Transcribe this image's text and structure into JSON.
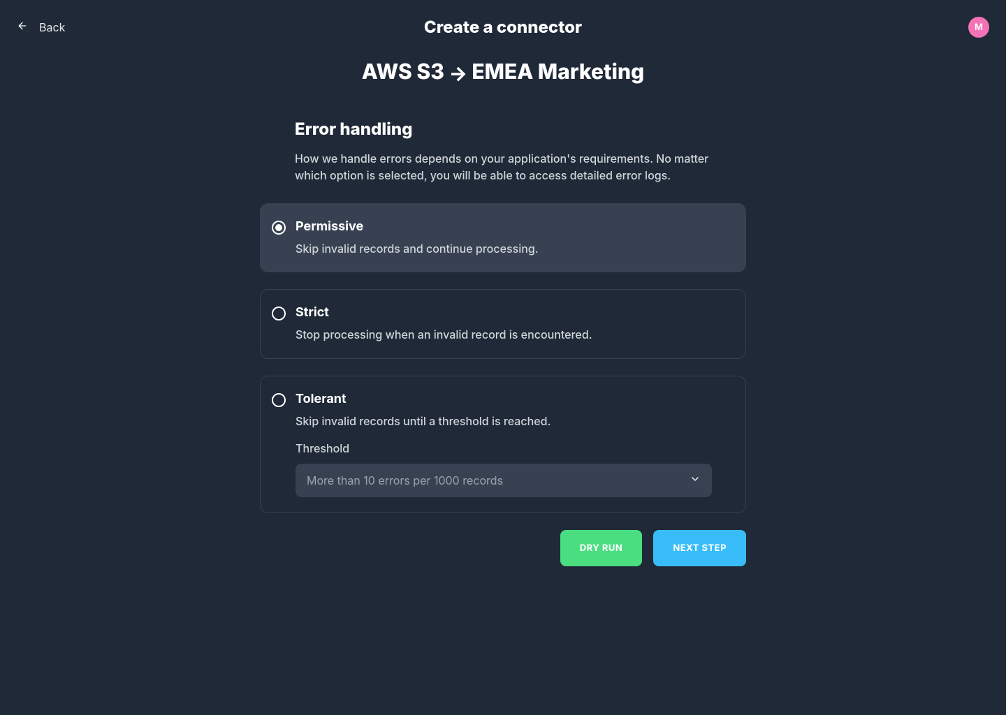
{
  "header": {
    "back_label": "Back",
    "title": "Create a connector",
    "avatar_initial": "M"
  },
  "subtitle": {
    "from": "AWS S3",
    "to": "EMEA Marketing"
  },
  "section": {
    "title": "Error handling",
    "description": "How we handle errors depends on your application's requirements. No matter which option is selected, you will be able to access detailed error logs."
  },
  "options": {
    "permissive": {
      "title": "Permissive",
      "description": "Skip invalid records and continue processing."
    },
    "strict": {
      "title": "Strict",
      "description": "Stop processing when an invalid record is encountered."
    },
    "tolerant": {
      "title": "Tolerant",
      "description": "Skip invalid records until a threshold is reached.",
      "threshold_label": "Threshold",
      "threshold_value": "More than 10 errors per 1000 records"
    }
  },
  "buttons": {
    "dry_run": "Dry Run",
    "next_step": "Next Step"
  }
}
